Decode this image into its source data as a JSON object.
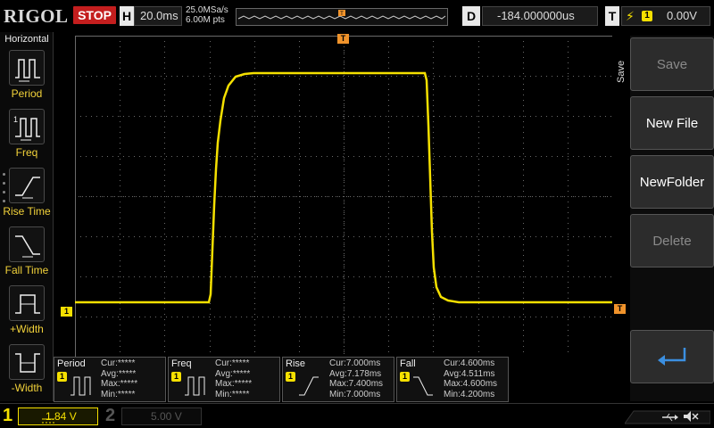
{
  "brand": "RIGOL",
  "run_state": "STOP",
  "horizontal": {
    "key": "H",
    "timebase": "20.0ms",
    "sample_rate": "25.0MSa/s",
    "memory_depth": "6.00M pts"
  },
  "delay": {
    "key": "D",
    "value": "-184.000000us"
  },
  "trigger": {
    "key": "T",
    "source": "1",
    "level": "0.00V",
    "slope_icon": "rising-edge-icon"
  },
  "left_menu": {
    "title": "Horizontal",
    "items": [
      {
        "label": "Period",
        "icon": "period-icon"
      },
      {
        "label": "Freq",
        "icon": "freq-icon"
      },
      {
        "label": "Rise Time",
        "icon": "rise-time-icon"
      },
      {
        "label": "Fall Time",
        "icon": "fall-time-icon"
      },
      {
        "label": "+Width",
        "icon": "positive-width-icon"
      },
      {
        "label": "-Width",
        "icon": "negative-width-icon"
      }
    ]
  },
  "right_menu": {
    "title": "Save",
    "buttons": [
      {
        "label": "Save",
        "enabled": false
      },
      {
        "label": "New File",
        "enabled": true
      },
      {
        "label": "NewFolder",
        "enabled": true
      },
      {
        "label": "Delete",
        "enabled": false
      }
    ],
    "enter_icon": "enter-icon"
  },
  "markers": {
    "channel": "1",
    "trigger_pos": "T",
    "trigger_level": "T"
  },
  "measurements": [
    {
      "name": "Period",
      "channel": "1",
      "cur": "Cur:*****",
      "avg": "Avg:*****",
      "max": "Max:*****",
      "min": "Min:*****"
    },
    {
      "name": "Freq",
      "channel": "1",
      "cur": "Cur:*****",
      "avg": "Avg:*****",
      "max": "Max:*****",
      "min": "Min:*****"
    },
    {
      "name": "Rise",
      "channel": "1",
      "cur": "Cur:7.000ms",
      "avg": "Avg:7.178ms",
      "max": "Max:7.400ms",
      "min": "Min:7.000ms"
    },
    {
      "name": "Fall",
      "channel": "1",
      "cur": "Cur:4.600ms",
      "avg": "Avg:4.511ms",
      "max": "Max:4.600ms",
      "min": "Min:4.200ms"
    }
  ],
  "channels": [
    {
      "number": "1",
      "scale": "1.84 V",
      "active": true,
      "color": "#f5e000"
    },
    {
      "number": "2",
      "scale": "5.00 V",
      "active": false,
      "color": "#4a4a4a"
    }
  ],
  "colors": {
    "trace": "#f5e000",
    "stop": "#c41e1e",
    "trigger_marker": "#f0932b",
    "grid": "#6a6a6a"
  },
  "status_icons": [
    "usb-icon",
    "mute-icon"
  ]
}
